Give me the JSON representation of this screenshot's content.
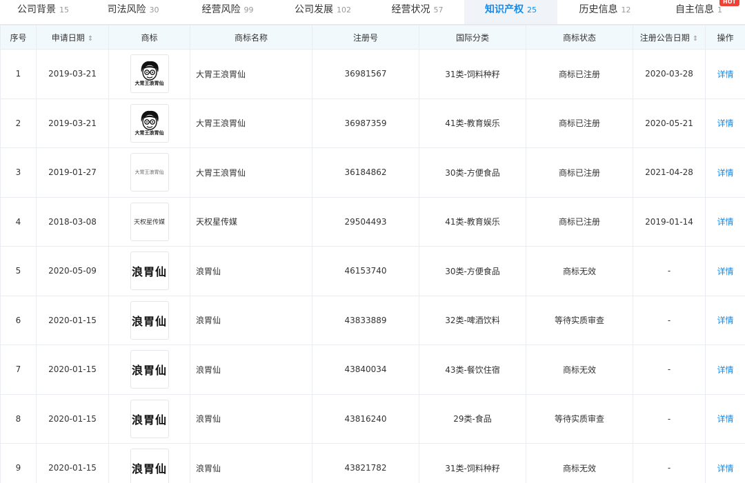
{
  "tabs": [
    {
      "label": "公司背景",
      "count": "15",
      "active": false
    },
    {
      "label": "司法风险",
      "count": "30",
      "active": false
    },
    {
      "label": "经营风险",
      "count": "99",
      "active": false
    },
    {
      "label": "公司发展",
      "count": "102",
      "active": false
    },
    {
      "label": "经营状况",
      "count": "57",
      "active": false
    },
    {
      "label": "知识产权",
      "count": "25",
      "active": true
    },
    {
      "label": "历史信息",
      "count": "12",
      "active": false
    },
    {
      "label": "自主信息",
      "count": "1",
      "active": false,
      "badge": "HOT"
    }
  ],
  "table": {
    "headers": {
      "index": "序号",
      "apply_date": "申请日期",
      "logo": "商标",
      "name": "商标名称",
      "reg_no": "注册号",
      "category": "国际分类",
      "status": "商标状态",
      "notice_date": "注册公告日期",
      "action": "操作"
    },
    "sort_icon": "⇕",
    "rows": [
      {
        "index": "1",
        "apply_date": "2019-03-21",
        "logo_type": "avatar",
        "logo_text": "大胃王浪胃仙",
        "name": "大胃王浪胃仙",
        "reg_no": "36981567",
        "category": "31类-饲料种籽",
        "status": "商标已注册",
        "notice_date": "2020-03-28",
        "action": "详情"
      },
      {
        "index": "2",
        "apply_date": "2019-03-21",
        "logo_type": "avatar",
        "logo_text": "大胃王浪胃仙",
        "name": "大胃王浪胃仙",
        "reg_no": "36987359",
        "category": "41类-教育娱乐",
        "status": "商标已注册",
        "notice_date": "2020-05-21",
        "action": "详情"
      },
      {
        "index": "3",
        "apply_date": "2019-01-27",
        "logo_type": "small",
        "logo_text": "大胃王浪胃仙",
        "name": "大胃王浪胃仙",
        "reg_no": "36184862",
        "category": "30类-方便食品",
        "status": "商标已注册",
        "notice_date": "2021-04-28",
        "action": "详情"
      },
      {
        "index": "4",
        "apply_date": "2018-03-08",
        "logo_type": "mid",
        "logo_text": "天权星传媒",
        "name": "天权星传媒",
        "reg_no": "29504493",
        "category": "41类-教育娱乐",
        "status": "商标已注册",
        "notice_date": "2019-01-14",
        "action": "详情"
      },
      {
        "index": "5",
        "apply_date": "2020-05-09",
        "logo_type": "bold",
        "logo_text": "浪胃仙",
        "name": "浪胃仙",
        "reg_no": "46153740",
        "category": "30类-方便食品",
        "status": "商标无效",
        "notice_date": "-",
        "action": "详情"
      },
      {
        "index": "6",
        "apply_date": "2020-01-15",
        "logo_type": "bold",
        "logo_text": "浪胃仙",
        "name": "浪胃仙",
        "reg_no": "43833889",
        "category": "32类-啤酒饮料",
        "status": "等待实质审查",
        "notice_date": "-",
        "action": "详情"
      },
      {
        "index": "7",
        "apply_date": "2020-01-15",
        "logo_type": "bold",
        "logo_text": "浪胃仙",
        "name": "浪胃仙",
        "reg_no": "43840034",
        "category": "43类-餐饮住宿",
        "status": "商标无效",
        "notice_date": "-",
        "action": "详情"
      },
      {
        "index": "8",
        "apply_date": "2020-01-15",
        "logo_type": "bold",
        "logo_text": "浪胃仙",
        "name": "浪胃仙",
        "reg_no": "43816240",
        "category": "29类-食品",
        "status": "等待实质审查",
        "notice_date": "-",
        "action": "详情"
      },
      {
        "index": "9",
        "apply_date": "2020-01-15",
        "logo_type": "bold",
        "logo_text": "浪胃仙",
        "name": "浪胃仙",
        "reg_no": "43821782",
        "category": "31类-饲料种籽",
        "status": "商标无效",
        "notice_date": "-",
        "action": "详情"
      }
    ]
  },
  "colors": {
    "accent": "#128bed",
    "active_tab_bg": "#f0f3f7",
    "header_bg": "#f2f9fc",
    "hot_badge": "#f04134"
  }
}
